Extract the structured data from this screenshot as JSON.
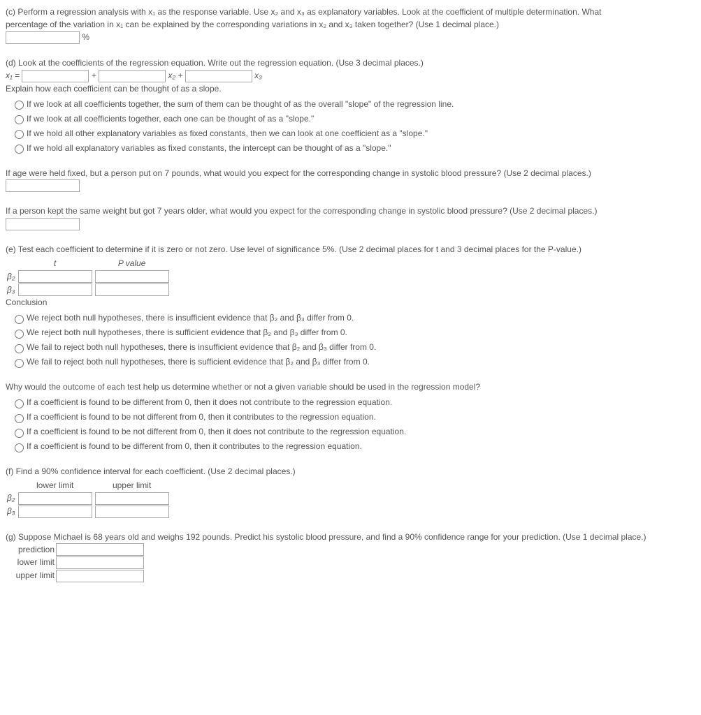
{
  "partC": {
    "prompt_line1": "(c) Perform a regression analysis with x₁ as the response variable. Use x₂ and x₃ as explanatory variables. Look at the coefficient of multiple determination. What",
    "prompt_line2": "percentage of the variation in x₁ can be explained by the corresponding variations in x₂ and x₃ taken together? (Use 1 decimal place.)",
    "percent_sign": "%"
  },
  "partD": {
    "prompt": "(d) Look at the coefficients of the regression equation. Write out the regression equation. (Use 3 decimal places.)",
    "x1eq": "x₁ =",
    "plus": "+",
    "x2": "x₂ +",
    "x3": "x₃",
    "explain": "Explain how each coefficient can be thought of as a slope.",
    "opts": [
      "If we look at all coefficients together, the sum of them can be thought of as the overall \"slope\" of the regression line.",
      "If we look at all coefficients together, each one can be thought of as a \"slope.\"",
      "If we hold all other explanatory variables as fixed constants, then we can look at one coefficient as a \"slope.\"",
      "If we hold all explanatory variables as fixed constants, the intercept can be thought of as a \"slope.\""
    ]
  },
  "ageQ": "If age were held fixed, but a person put on 7 pounds, what would you expect for the corresponding change in systolic blood pressure? (Use 2 decimal places.)",
  "weightQ": "If a person kept the same weight but got 7 years older, what would you expect for the corresponding change in systolic blood pressure? (Use 2 decimal places.)",
  "partE": {
    "prompt": "(e) Test each coefficient to determine if it is zero or not zero. Use level of significance 5%. (Use 2 decimal places for t and 3 decimal places for the P-value.)",
    "col_t": "t",
    "col_p": "P value",
    "b2": "β₂",
    "b3": "β₃",
    "conclusion": "Conclusion",
    "opts": [
      "We reject both null hypotheses, there is insufficient evidence that β₂ and β₃ differ from 0.",
      "We reject both null hypotheses, there is sufficient evidence that β₂ and β₃ differ from 0.",
      "We fail to reject both null hypotheses, there is insufficient evidence that β₂ and β₃ differ from 0.",
      "We fail to reject both null hypotheses, there is sufficient evidence that β₂ and β₃ differ from 0."
    ]
  },
  "whyQ": {
    "prompt": "Why would the outcome of each test help us determine whether or not a given variable should be used in the regression model?",
    "opts": [
      "If a coefficient is found to be different from 0, then it does not contribute to the regression equation.",
      "If a coefficient is found to be not different from 0, then it contributes to the regression equation.",
      "If a coefficient is found to be not different from 0, then it does not contribute to the regression equation.",
      "If a coefficient is found to be different from 0, then it contributes to the regression equation."
    ]
  },
  "partF": {
    "prompt": "(f) Find a 90% confidence interval for each coefficient. (Use 2 decimal places.)",
    "col_low": "lower limit",
    "col_up": "upper limit",
    "b2": "β₂",
    "b3": "β₃"
  },
  "partG": {
    "prompt": "(g) Suppose Michael is 68 years old and weighs 192 pounds. Predict his systolic blood pressure, and find a 90% confidence range for your prediction. (Use 1 decimal place.)",
    "pred": "prediction",
    "low": "lower limit",
    "up": "upper limit"
  }
}
